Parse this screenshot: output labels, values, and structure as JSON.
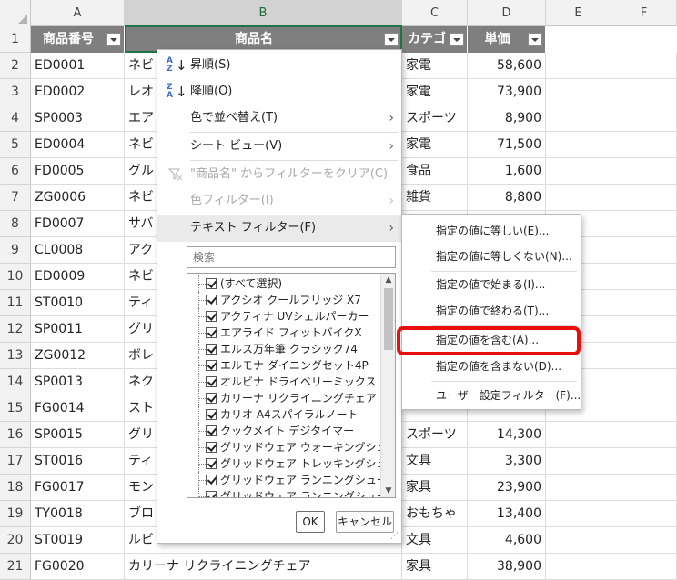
{
  "columns": [
    "A",
    "B",
    "C",
    "D",
    "E",
    "F"
  ],
  "header": {
    "a": "商品番号",
    "b": "商品名",
    "c": "カテゴリ",
    "d": "単価"
  },
  "rows": [
    {
      "n": "2",
      "a": "ED0001",
      "b": "ネビ",
      "c": "家電",
      "d": "58,600"
    },
    {
      "n": "3",
      "a": "ED0002",
      "b": "レオ",
      "c": "家電",
      "d": "73,900"
    },
    {
      "n": "4",
      "a": "SP0003",
      "b": "エア",
      "c": "スポーツ",
      "d": "8,900"
    },
    {
      "n": "5",
      "a": "ED0004",
      "b": "ネビ",
      "c": "家電",
      "d": "71,500"
    },
    {
      "n": "6",
      "a": "FD0005",
      "b": "グル",
      "c": "食品",
      "d": "1,600"
    },
    {
      "n": "7",
      "a": "ZG0006",
      "b": "ネビ",
      "c": "雑貨",
      "d": "8,800"
    },
    {
      "n": "8",
      "a": "FD0007",
      "b": "サバ",
      "c": "",
      "d": ""
    },
    {
      "n": "9",
      "a": "CL0008",
      "b": "アク",
      "c": "",
      "d": ""
    },
    {
      "n": "10",
      "a": "ED0009",
      "b": "ネビ",
      "c": "",
      "d": ""
    },
    {
      "n": "11",
      "a": "ST0010",
      "b": "ティ",
      "c": "",
      "d": ""
    },
    {
      "n": "12",
      "a": "SP0011",
      "b": "グリ",
      "c": "",
      "d": ""
    },
    {
      "n": "13",
      "a": "ZG0012",
      "b": "ボレ",
      "c": "",
      "d": ""
    },
    {
      "n": "14",
      "a": "SP0013",
      "b": "ネク",
      "c": "",
      "d": ""
    },
    {
      "n": "15",
      "a": "FG0014",
      "b": "スト",
      "c": "",
      "d": ""
    },
    {
      "n": "16",
      "a": "SP0015",
      "b": "グリ",
      "c": "スポーツ",
      "d": "14,300"
    },
    {
      "n": "17",
      "a": "ST0016",
      "b": "ティ",
      "c": "文具",
      "d": "3,300"
    },
    {
      "n": "18",
      "a": "FG0017",
      "b": "モン",
      "c": "家具",
      "d": "23,900"
    },
    {
      "n": "19",
      "a": "TY0018",
      "b": "ブロ",
      "c": "おもちゃ",
      "d": "13,400"
    },
    {
      "n": "20",
      "a": "ST0019",
      "b": "ルビ",
      "c": "文具",
      "d": "4,600"
    },
    {
      "n": "21",
      "a": "FG0020",
      "b": "カリーナ リクライニングチェア",
      "c": "家具",
      "d": "38,900"
    }
  ],
  "menu": {
    "sort_asc": "昇順(S)",
    "sort_desc": "降順(O)",
    "sort_by_color": "色で並べ替え(T)",
    "sheet_view": "シート ビュー(V)",
    "clear_filter": "\"商品名\" からフィルターをクリア(C)",
    "color_filter": "色フィルター(I)",
    "text_filter": "テキスト フィルター(F)",
    "search_placeholder": "検索",
    "items": [
      "(すべて選択)",
      "アクシオ クールフリッジ X7",
      "アクティナ UVシェルパーカー",
      "エアライド フィットバイクX",
      "エルス万年筆 クラシック74",
      "エルモナ ダイニングセット4P",
      "オルビナ ドライベリーミックス",
      "カリーナ リクライニングチェア",
      "カリオ A4スパイラルノート",
      "クックメイト デジタイマー",
      "グリッドウェア ウォーキングシューズ",
      "グリッドウェア トレッキングシューズ",
      "グリッドウェア ランニングシューズ",
      "グリッドウェア ランニングシューズ Lite"
    ],
    "ok": "OK",
    "cancel": "キャンセル"
  },
  "submenu": {
    "equals": "指定の値に等しい(E)...",
    "not_equals": "指定の値に等しくない(N)...",
    "begins_with": "指定の値で始まる(I)...",
    "ends_with": "指定の値で終わる(T)...",
    "contains": "指定の値を含む(A)...",
    "not_contains": "指定の値を含まない(D)...",
    "custom": "ユーザー設定フィルター(F)..."
  },
  "colors": {
    "header_bg": "#7f7f7f",
    "highlight": "#e80f0f",
    "selection": "#217346",
    "sort_icon": "#3c6ec8"
  }
}
